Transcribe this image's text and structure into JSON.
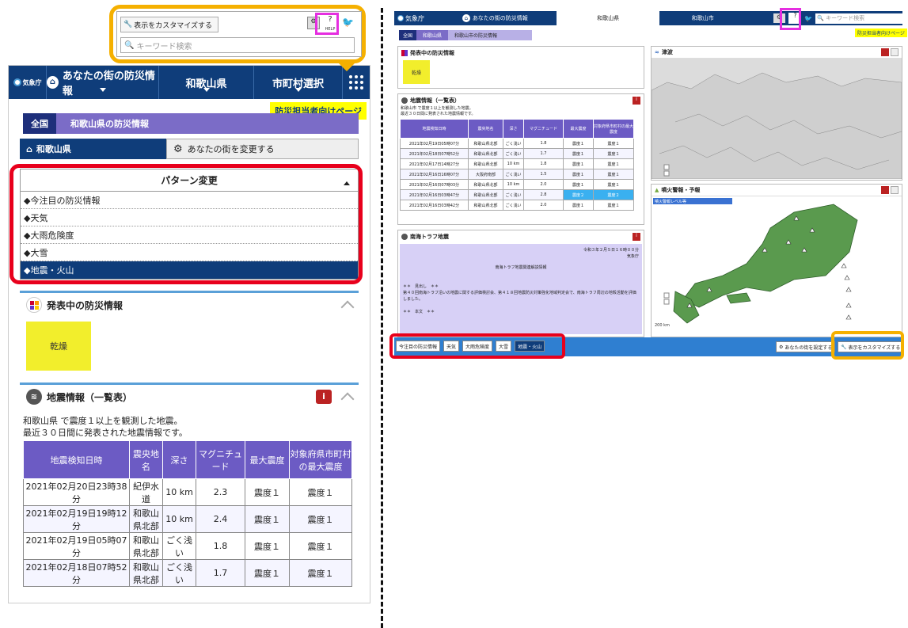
{
  "tooltip": {
    "customize_label": "表示をカスタマイズする",
    "help_label": "HELP",
    "search_placeholder": "キーワード検索"
  },
  "mobile": {
    "logo": "気象庁",
    "nav": {
      "local_info": "あなたの街の防災情報",
      "prefecture": "和歌山県",
      "city": "市町村選択"
    },
    "bosai_link": "防災担当者向けページ",
    "breadcrumb": {
      "home": "全国",
      "current": "和歌山県の防災情報"
    },
    "pref_button": "和歌山県",
    "change_city": "あなたの街を変更する",
    "pattern": {
      "title": "パターン変更",
      "items": [
        "◆今注目の防災情報",
        "◆天気",
        "◆大雨危険度",
        "◆大雪",
        "◆地震・火山"
      ]
    },
    "warning": {
      "title": "発表中の防災情報",
      "badge": "乾燥"
    },
    "quake": {
      "title": "地震情報（一覧表）",
      "desc1": "和歌山県 で震度１以上を観測した地震。",
      "desc2": "最近３０日間に発表された地震情報です。",
      "headers": [
        "地震検知日時",
        "震央地名",
        "深さ",
        "マグニチュード",
        "最大震度",
        "対象府県市町村の最大震度"
      ],
      "rows": [
        [
          "2021年02月20日23時38分",
          "紀伊水道",
          "10 km",
          "2.3",
          "震度１",
          "震度１"
        ],
        [
          "2021年02月19日19時12分",
          "和歌山県北部",
          "10 km",
          "2.4",
          "震度１",
          "震度１"
        ],
        [
          "2021年02月19日05時07分",
          "和歌山県北部",
          "ごく浅い",
          "1.8",
          "震度１",
          "震度１"
        ],
        [
          "2021年02月18日07時52分",
          "和歌山県北部",
          "ごく浅い",
          "1.7",
          "震度１",
          "震度１"
        ]
      ]
    }
  },
  "desktop": {
    "logo": "気象庁",
    "nav": {
      "local_info": "あなたの街の防災情報",
      "prefecture": "和歌山県",
      "city": "和歌山市"
    },
    "search_placeholder": "キーワード検索",
    "bosai_link": "防災担当者向けページ",
    "breadcrumb": {
      "home": "全国",
      "pref": "和歌山県",
      "current": "和歌山市の防災情報"
    },
    "warning": {
      "title": "発表中の防災情報",
      "badge": "乾燥"
    },
    "quake": {
      "title": "地震情報（一覧表）",
      "desc1": "和歌山市 で震度１以上を観測した地震。",
      "desc2": "最近３０日間に発表された地震情報です。",
      "headers": [
        "地震検知日時",
        "震央地名",
        "深さ",
        "マグニチュード",
        "最大震度",
        "対象府県市町村の最大震度"
      ],
      "rows": [
        [
          "2021年02月19日05時07分",
          "和歌山県北部",
          "ごく浅い",
          "1.8",
          "震度１",
          "震度１"
        ],
        [
          "2021年02月18日07時52分",
          "和歌山県北部",
          "ごく浅い",
          "1.7",
          "震度１",
          "震度１"
        ],
        [
          "2021年02月17日14時27分",
          "和歌山県北部",
          "10 km",
          "1.8",
          "震度１",
          "震度１"
        ],
        [
          "2021年02月16日16時07分",
          "大阪府南部",
          "ごく浅い",
          "1.5",
          "震度１",
          "震度１"
        ],
        [
          "2021年02月16日07時03分",
          "和歌山県北部",
          "10 km",
          "2.0",
          "震度１",
          "震度１"
        ],
        [
          "2021年02月16日03時47分",
          "和歌山県北部",
          "ごく浅い",
          "2.8",
          "震度２",
          "震度２"
        ],
        [
          "2021年02月16日03時42分",
          "和歌山県北部",
          "ごく浅い",
          "2.0",
          "震度１",
          "震度１"
        ]
      ]
    },
    "trough": {
      "title": "南海トラフ地震",
      "date": "令和３年２月５日１６時００分",
      "issuer": "気象庁",
      "heading": "南海トラフ地震関連解説情報",
      "body1": "＊＊　見出し　＊＊",
      "body2": "第４０回南海トラフ沿いの地震に関する評価検討会、第４１８回地震防災対策強化地域判定会で、南海トラフ周辺の地殻活動を評価しました。",
      "body3": "＊＊　本文　＊＊"
    },
    "tsunami_title": "津波",
    "volcano_title": "噴火警報・予報",
    "volcano_legend": "噴火警報レベル等",
    "map_scale": "200 km",
    "tabs": [
      "今注目の防災情報",
      "天気",
      "大雨危険度",
      "大雪",
      "地震・火山"
    ],
    "change_city": "あなたの街を設定する",
    "customize": "表示をカスタマイズする"
  }
}
